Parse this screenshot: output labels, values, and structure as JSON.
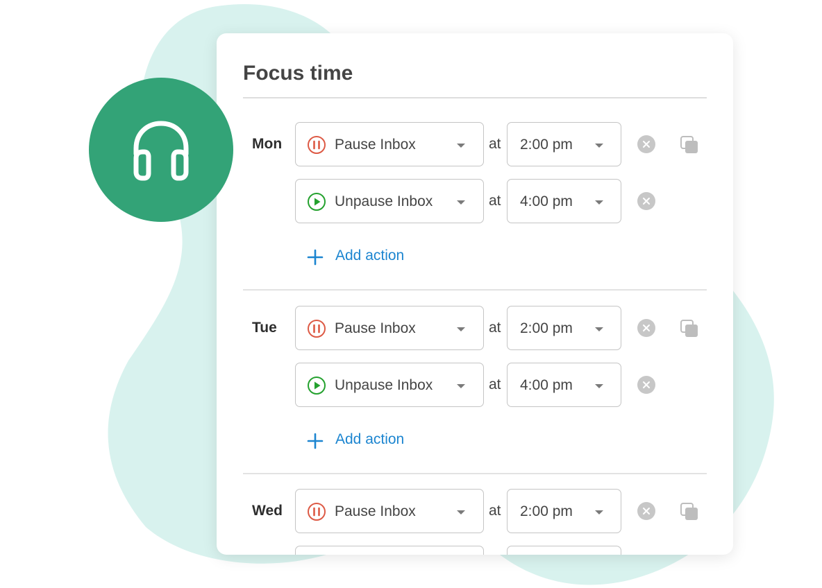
{
  "colors": {
    "blob": "#d8f2ee",
    "badge": "#33a377",
    "badge_icon": "#ffffff",
    "pause": "#dd5a45",
    "unpause": "#24a12e",
    "link": "#1c85d0"
  },
  "badge": {
    "icon": "headphones-icon"
  },
  "card": {
    "title": "Focus time",
    "days": [
      {
        "label": "Mon",
        "add_action_label": "Add action",
        "actions": [
          {
            "icon": "pause-circle-icon",
            "action": "Pause Inbox",
            "at": "at",
            "time": "2:00 pm"
          },
          {
            "icon": "play-circle-icon",
            "action": "Unpause Inbox",
            "at": "at",
            "time": "4:00 pm"
          }
        ]
      },
      {
        "label": "Tue",
        "add_action_label": "Add action",
        "actions": [
          {
            "icon": "pause-circle-icon",
            "action": "Pause Inbox",
            "at": "at",
            "time": "2:00 pm"
          },
          {
            "icon": "play-circle-icon",
            "action": "Unpause Inbox",
            "at": "at",
            "time": "4:00 pm"
          }
        ]
      },
      {
        "label": "Wed",
        "add_action_label": "",
        "actions": [
          {
            "icon": "pause-circle-icon",
            "action": "Pause Inbox",
            "at": "at",
            "time": "2:00 pm"
          },
          {
            "icon": "play-circle-icon",
            "action": "",
            "at": "",
            "time": ""
          }
        ]
      }
    ]
  }
}
